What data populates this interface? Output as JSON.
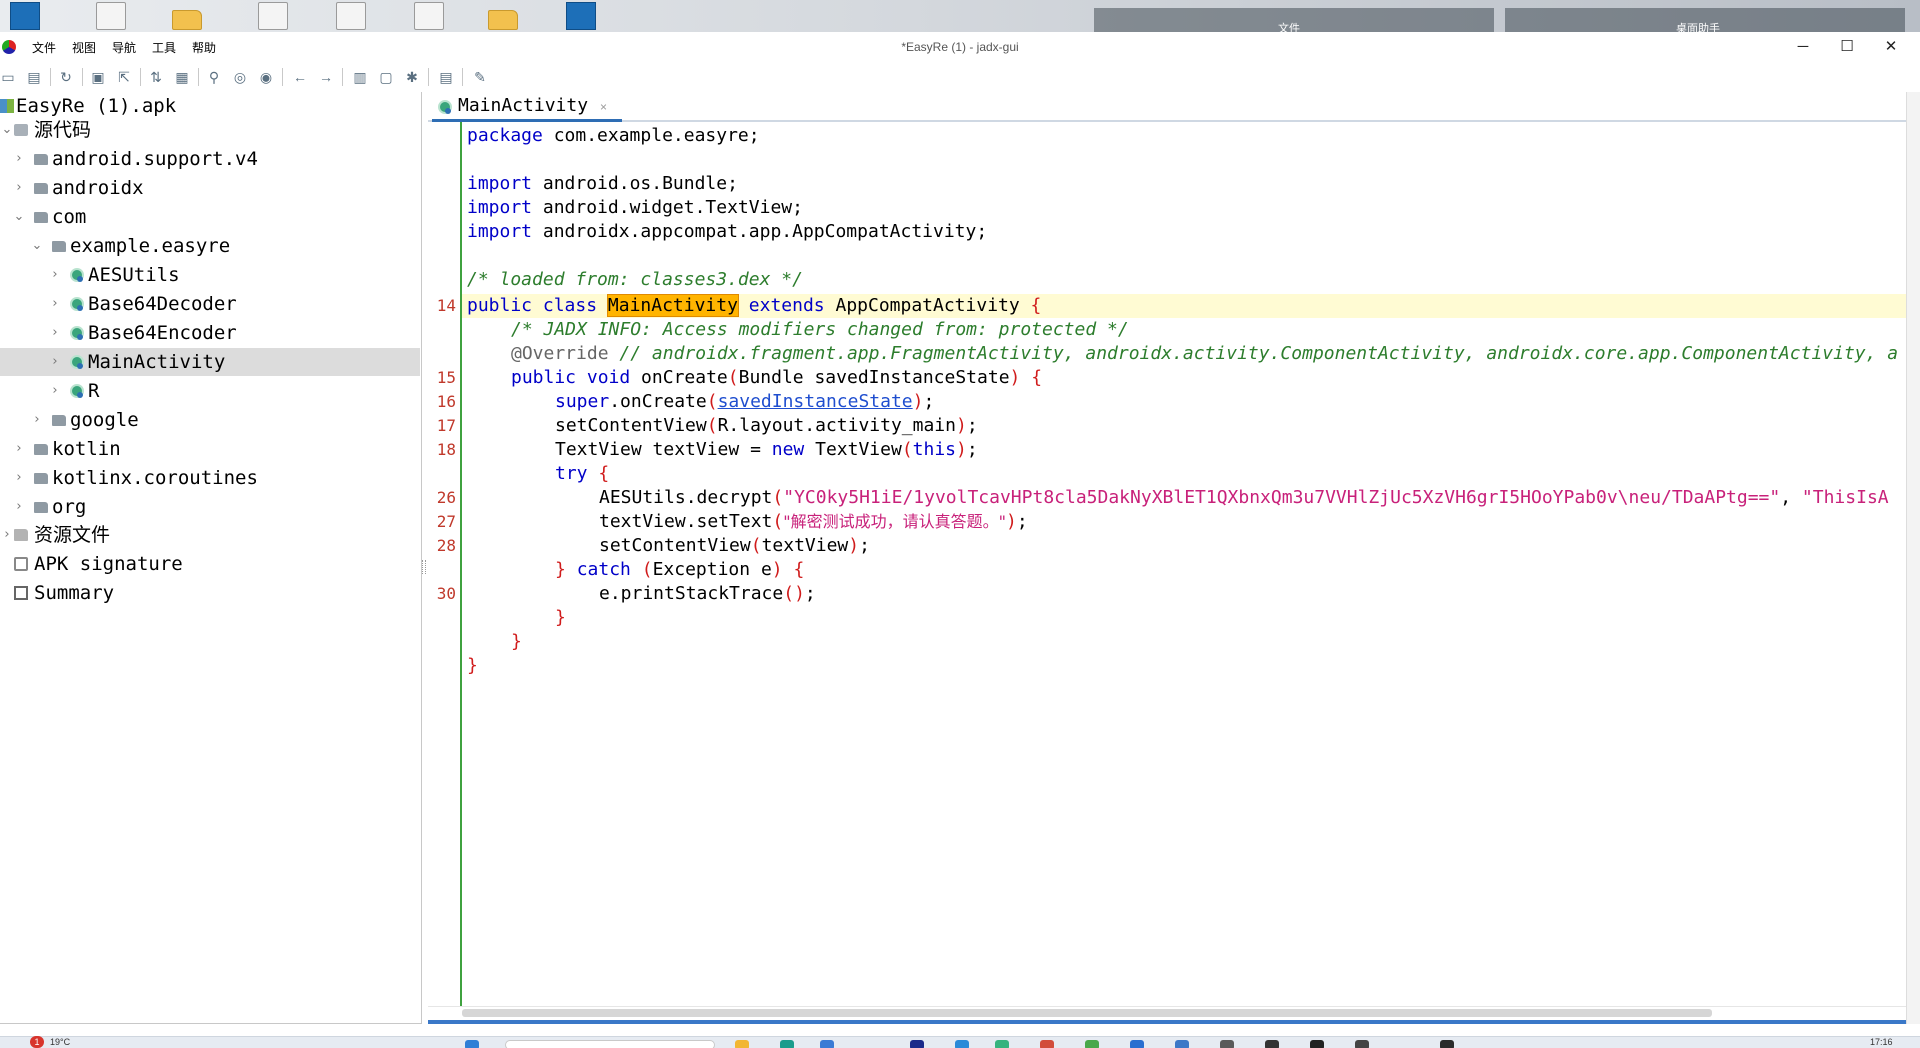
{
  "desktop": {
    "label_1": "文件",
    "label_2": "桌面助手"
  },
  "window": {
    "title": "*EasyRe (1) - jadx-gui",
    "minimize": "─",
    "maximize": "☐",
    "close": "✕"
  },
  "menu": {
    "items": [
      "文件",
      "视图",
      "导航",
      "工具",
      "帮助"
    ]
  },
  "toolbar": {
    "icons": [
      "open-icon",
      "add-files-icon",
      "reload-icon",
      "save-icon",
      "export-icon",
      "sync-icon",
      "flatten-icon",
      "search-icon",
      "find-class-icon",
      "find-usage-icon",
      "back-icon",
      "forward-icon",
      "quark-icon",
      "deobfuscation-icon",
      "debug-icon",
      "log-icon",
      "preferences-icon"
    ]
  },
  "tree": {
    "root": "EasyRe (1).apk",
    "source_code": "源代码",
    "pkg_support": "android.support.v4",
    "pkg_androidx": "androidx",
    "pkg_com": "com",
    "pkg_example": "example.easyre",
    "cls_aes": "AESUtils",
    "cls_b64d": "Base64Decoder",
    "cls_b64e": "Base64Encoder",
    "cls_main": "MainActivity",
    "cls_r": "R",
    "pkg_google": "google",
    "pkg_kotlin": "kotlin",
    "pkg_kotlinx": "kotlinx.coroutines",
    "pkg_org": "org",
    "resources": "资源文件",
    "apk_signature": "APK signature",
    "summary": "Summary"
  },
  "editor": {
    "tab_label": "MainActivity",
    "tab_close": "×",
    "line_numbers": {
      "l14": "14",
      "l15": "15",
      "l16": "16",
      "l17": "17",
      "l18": "18",
      "l26": "26",
      "l27": "27",
      "l28": "28",
      "l30": "30"
    },
    "code": {
      "c1_kw": "package",
      "c1_rest": " com.example.easyre;",
      "c3_kw": "import",
      "c3_rest": " android.os.Bundle;",
      "c4_kw": "import",
      "c4_rest": " android.widget.TextView;",
      "c5_kw": "import",
      "c5_rest": " androidx.appcompat.app.AppCompatActivity;",
      "c7_comment": "/* loaded from: classes3.dex */",
      "c8_kw": "public class ",
      "c8_name": "MainActivity",
      "c8_kw2": " extends",
      "c8_rest": " AppCompatActivity ",
      "c8_brace": "{",
      "c9_comment": "/* JADX INFO: Access modifiers changed from: protected */",
      "c10_anno": "@Override",
      "c10_comment": " // androidx.fragment.app.FragmentActivity, androidx.activity.ComponentActivity, androidx.core.app.ComponentActivity, a",
      "c11_kw": "public void",
      "c11_rest": " onCreate",
      "c11_br1": "(",
      "c11_params": "Bundle savedInstanceState",
      "c11_br2": ") {",
      "c12_kw": "super",
      "c12_rest": ".onCreate",
      "c12_br1": "(",
      "c12_link": "savedInstanceState",
      "c12_br2": ")",
      "c12_end": ";",
      "c13_rest": "setContentView",
      "c13_br1": "(",
      "c13_arg": "R.layout.activity_main",
      "c13_br2": ")",
      "c13_end": ";",
      "c14_rest": "TextView textView = ",
      "c14_kw": "new",
      "c14_rest2": " TextView",
      "c14_br1": "(",
      "c14_kw2": "this",
      "c14_br2": ")",
      "c14_end": ";",
      "c15_kw": "try",
      "c15_br": " {",
      "c16_rest": "AESUtils.decrypt",
      "c16_br1": "(",
      "c16_str1": "\"YC0ky5H1iE/1yvolTcavHPt8cla5DakNyXBlET1QXbnxQm3u7VVHlZjUc5XzVH6grI5HOoYPab0v\\neu/TDaAPtg==\"",
      "c16_comma": ", ",
      "c16_str2": "\"ThisIsA",
      "c17_rest": "textView.setText",
      "c17_br1": "(",
      "c17_str": "\"解密测试成功，请认真答题。\"",
      "c17_br2": ")",
      "c17_end": ";",
      "c18_rest": "setContentView",
      "c18_br1": "(",
      "c18_arg": "textView",
      "c18_br2": ")",
      "c18_end": ";",
      "c19_br": "} ",
      "c19_kw": "catch",
      "c19_br1": " (",
      "c19_type": "Exception",
      "c19_var": " e",
      "c19_br2": ") {",
      "c20_rest": "e.printStackTrace",
      "c20_br": "()",
      "c20_end": ";",
      "c21_br": "}",
      "c22_br": "}",
      "c23_br": "}"
    }
  },
  "taskbar": {
    "badge": "1",
    "temperature": "19°C",
    "clock": "17:16"
  }
}
